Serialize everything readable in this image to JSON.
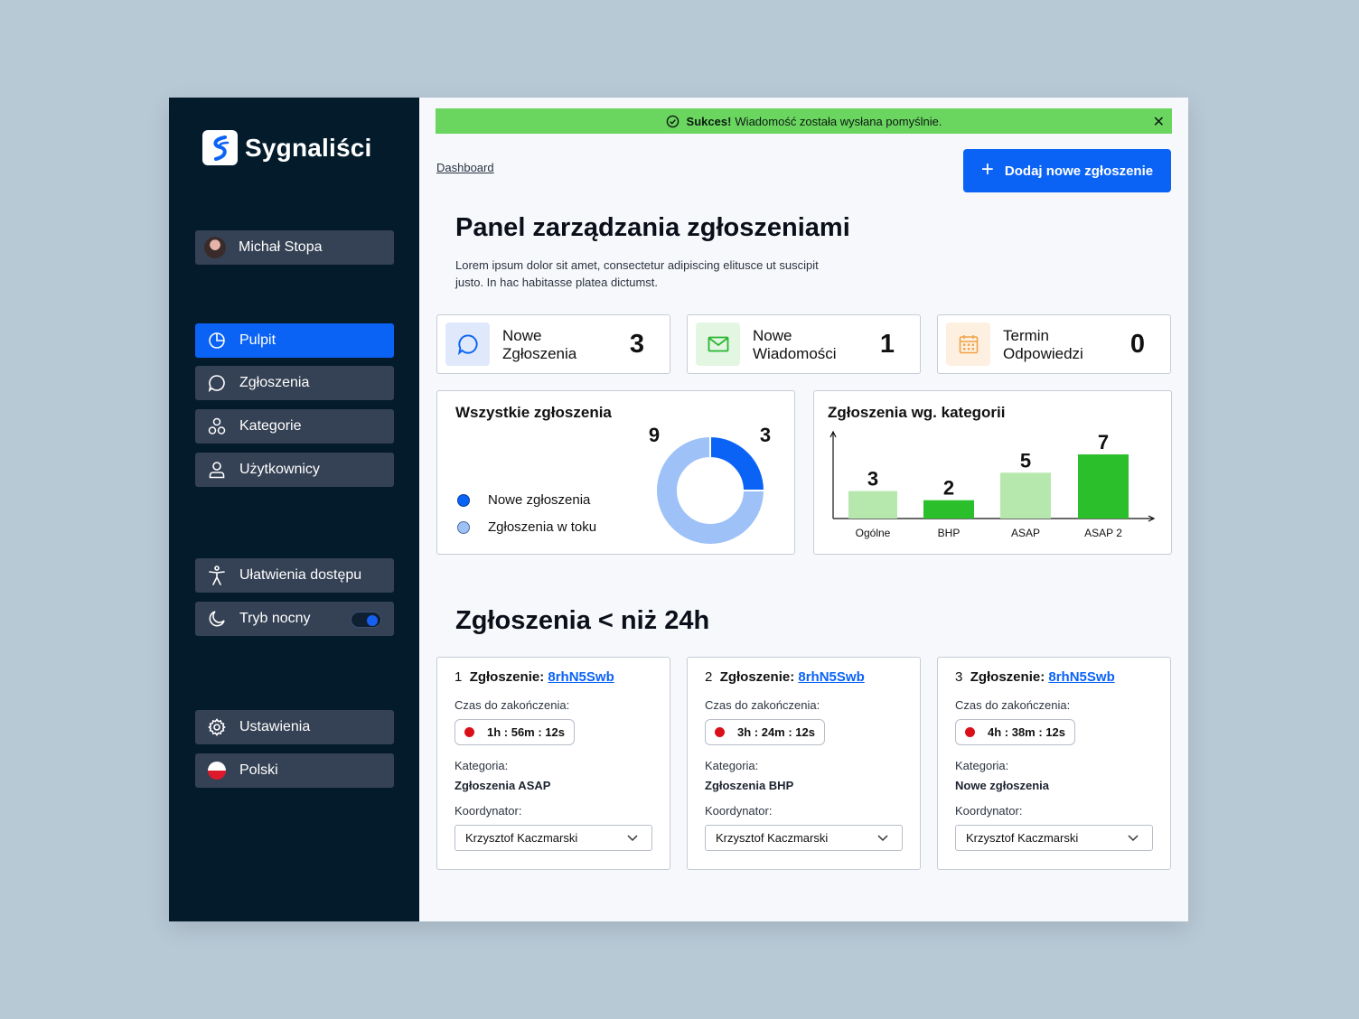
{
  "app": {
    "name": "Sygnaliści"
  },
  "sidebar": {
    "user": "Michał Stopa",
    "nav": [
      {
        "label": "Pulpit",
        "icon": "pie-chart-icon",
        "active": true
      },
      {
        "label": "Zgłoszenia",
        "icon": "chat-bubble-icon"
      },
      {
        "label": "Kategorie",
        "icon": "categories-icon"
      },
      {
        "label": "Użytkownicy",
        "icon": "user-icon"
      }
    ],
    "accessibility": "Ułatwienia dostępu",
    "night_mode": {
      "label": "Tryb nocny",
      "on": true
    },
    "settings": "Ustawienia",
    "language": "Polski"
  },
  "toast": {
    "bold": "Sukces!",
    "message": "Wiadomość została wysłana pomyślnie.",
    "close": "✕"
  },
  "breadcrumb": "Dashboard",
  "add_button": {
    "plus": "+",
    "label": "Dodaj nowe zgłoszenie"
  },
  "header": {
    "title": "Panel zarządzania zgłoszeniami",
    "description": "Lorem ipsum dolor sit amet, consectetur adipiscing elitusce ut suscipit justo. In hac habitasse platea dictumst."
  },
  "stats": [
    {
      "line1": "Nowe",
      "line2": "Zgłoszenia",
      "value": "3",
      "icon": "chat-bubble-icon",
      "color": "#0b63f6",
      "bg": "#dfe9fb"
    },
    {
      "line1": "Nowe",
      "line2": "Wiadomości",
      "value": "1",
      "icon": "mail-icon",
      "color": "#2ab52f",
      "bg": "#e2f6e2"
    },
    {
      "line1": "Termin",
      "line2": "Odpowiedzi",
      "value": "0",
      "icon": "calendar-icon",
      "color": "#f0a347",
      "bg": "#fdf0e0"
    }
  ],
  "donut_card": {
    "title": "Wszystkie zgłoszenia",
    "legend": [
      {
        "label": "Nowe zgłoszenia",
        "color": "#0b63f6"
      },
      {
        "label": "Zgłoszenia w toku",
        "color": "#9ec2f7"
      }
    ]
  },
  "bar_card": {
    "title": "Zgłoszenia wg. kategorii"
  },
  "chart_data": [
    {
      "type": "pie",
      "title": "Wszystkie zgłoszenia",
      "labels": [
        "Nowe zgłoszenia",
        "Zgłoszenia w toku"
      ],
      "values": [
        3,
        9
      ],
      "colors": [
        "#0b63f6",
        "#9ec2f7"
      ],
      "legend": "left"
    },
    {
      "type": "bar",
      "title": "Zgłoszenia wg. kategorii",
      "categories": [
        "Ogólne",
        "BHP",
        "ASAP",
        "ASAP 2"
      ],
      "values": [
        3,
        2,
        5,
        7
      ],
      "colors": [
        "#b6e8ad",
        "#2bc02b",
        "#b6e8ad",
        "#2bc02b"
      ],
      "ylim": [
        0,
        7
      ]
    }
  ],
  "section": {
    "title": "Zgłoszenia < niż 24h"
  },
  "tickets": [
    {
      "num": "1",
      "label": "Zgłoszenie:",
      "id": "8rhN5Swb",
      "time_label": "Czas do zakończenia:",
      "time": "1h : 56m : 12s",
      "cat_label": "Kategoria:",
      "category": "Zgłoszenia ASAP",
      "coord_label": "Koordynator:",
      "coordinator": "Krzysztof Kaczmarski"
    },
    {
      "num": "2",
      "label": "Zgłoszenie:",
      "id": "8rhN5Swb",
      "time_label": "Czas do zakończenia:",
      "time": "3h : 24m : 12s",
      "cat_label": "Kategoria:",
      "category": "Zgłoszenia BHP",
      "coord_label": "Koordynator:",
      "coordinator": "Krzysztof Kaczmarski"
    },
    {
      "num": "3",
      "label": "Zgłoszenie:",
      "id": "8rhN5Swb",
      "time_label": "Czas do zakończenia:",
      "time": "4h : 38m : 12s",
      "cat_label": "Kategoria:",
      "category": "Nowe zgłoszenia",
      "coord_label": "Koordynator:",
      "coordinator": "Krzysztof Kaczmarski"
    }
  ]
}
